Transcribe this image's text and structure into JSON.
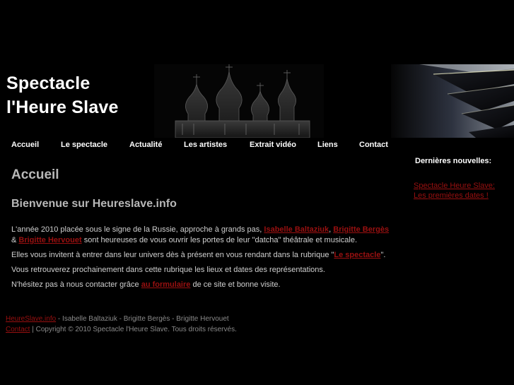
{
  "header": {
    "title_line1": "Spectacle",
    "title_line2": "l'Heure Slave"
  },
  "nav": {
    "items": [
      {
        "label": "Accueil"
      },
      {
        "label": "Le spectacle"
      },
      {
        "label": "Actualité"
      },
      {
        "label": "Les artistes"
      },
      {
        "label": "Extrait vidéo"
      },
      {
        "label": "Liens"
      },
      {
        "label": "Contact"
      }
    ]
  },
  "main": {
    "page_title": "Accueil",
    "welcome_title": "Bienvenue sur Heureslave.info",
    "p1_before": "L'année 2010 placée sous le signe de la Russie, approche à grands pas, ",
    "p1_link1": "Isabelle Baltaziuk",
    "p1_sep1": ", ",
    "p1_link2": "Brigitte Bergès",
    "p1_sep2": " & ",
    "p1_link3": "Brigitte Hervouet",
    "p1_after": " sont heureuses de vous ouvrir les portes de leur \"datcha\" théâtrale et musicale.",
    "p2_before": "Elles vous invitent à entrer dans leur univers dès à présent en vous rendant dans la rubrique \"",
    "p2_link": "Le spectacle",
    "p2_after": "\".",
    "p3": "Vous retrouverez prochainement dans cette rubrique les lieux et dates des représentations.",
    "p4_before": "N'hésitez pas à nous contacter grâce ",
    "p4_link": "au formulaire",
    "p4_after": " de ce site et bonne visite."
  },
  "sidebar": {
    "title": "Dernières nouvelles:",
    "news_link": "Spectacle Heure Slave: Les premières dates !"
  },
  "footer": {
    "site_link": "HeureSlave.info",
    "line1_after": " - Isabelle Baltaziuk - Brigitte Bergès - Brigitte Hervouet",
    "contact_link": "Contact",
    "line2_after": " | Copyright © 2010 Spectacle l'Heure Slave. Tous droits réservés."
  },
  "colors": {
    "background": "#000000",
    "link": "#9a1010",
    "heading": "#b8b8b8",
    "text": "#cfcfcf"
  }
}
